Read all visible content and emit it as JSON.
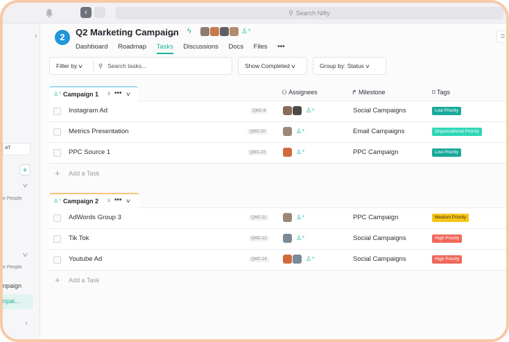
{
  "search": {
    "placeholder": "Search Nifty"
  },
  "sidebar": {
    "labels": [
      "AT",
      "e People",
      "e People",
      "npaign",
      "npai..."
    ]
  },
  "project": {
    "badge": "2",
    "title": "Q2 Marketing Campaign",
    "tabs": [
      "Dashboard",
      "Roadmap",
      "Tasks",
      "Discussions",
      "Docs",
      "Files"
    ],
    "active_tab": "Tasks"
  },
  "filters": {
    "filter_by": "Filter by",
    "search_placeholder": "Search tasks...",
    "show_completed": "Show Completed",
    "group_by_label": "Group by:",
    "group_by_value": "Status"
  },
  "columns": {
    "assignees": "Assignees",
    "milestone": "Milestone",
    "tags": "Tags"
  },
  "add_task_label": "Add a Task",
  "groups": [
    {
      "name": "Campaign 1",
      "count": "3",
      "tasks": [
        {
          "name": "Instagram Ad",
          "id": "QMC-8",
          "milestone": "Social Campaigns",
          "tag": "Low Priority"
        },
        {
          "name": "Metrics Presentation",
          "id": "QMC-20",
          "milestone": "Email Campaigns",
          "tag": "Organizational Priority"
        },
        {
          "name": "PPC Source 1",
          "id": "QMC-23",
          "milestone": "PPC Campaign",
          "tag": "Low Priority"
        }
      ]
    },
    {
      "name": "Campaign 2",
      "count": "3",
      "tasks": [
        {
          "name": "AdWords Group 3",
          "id": "QMC-11",
          "milestone": "PPC Campaign",
          "tag": "Medium Priority"
        },
        {
          "name": "Tik Tok",
          "id": "QMC-22",
          "milestone": "Social Campaigns",
          "tag": "High Priority"
        },
        {
          "name": "Youtube Ad",
          "id": "QMC-24",
          "milestone": "Social Campaigns",
          "tag": "High Priority"
        }
      ]
    }
  ],
  "colors": {
    "accent": "#1fb29e",
    "low_priority": "#1aa99a",
    "organizational_priority": "#2fd6b8",
    "medium_priority": "#f5c518",
    "high_priority": "#f0675a"
  }
}
